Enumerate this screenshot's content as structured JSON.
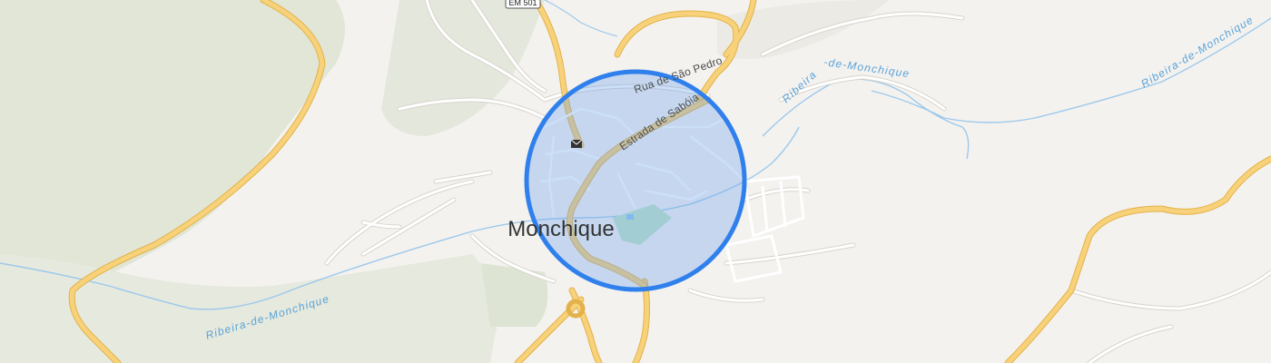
{
  "map": {
    "place": "Monchique",
    "route_shield": "EM 501",
    "roads": {
      "sao_pedro": "Rua de São Pedro",
      "sabola": "Estrada de Sabóia"
    },
    "rivers": {
      "left": "Ribeira-de-Monchique",
      "middle": "Ribeira-de-Monchique",
      "right": "Ribeira-de-Monchique"
    },
    "colors": {
      "background": "#f4f2ef",
      "vegetation": "#e4e8dc",
      "major_road": "#f5c85b",
      "minor_road": "#ffffff",
      "water": "#8cc2e8",
      "location_circle_stroke": "#2f80ed",
      "location_circle_fill": "#6ea2ee"
    }
  }
}
